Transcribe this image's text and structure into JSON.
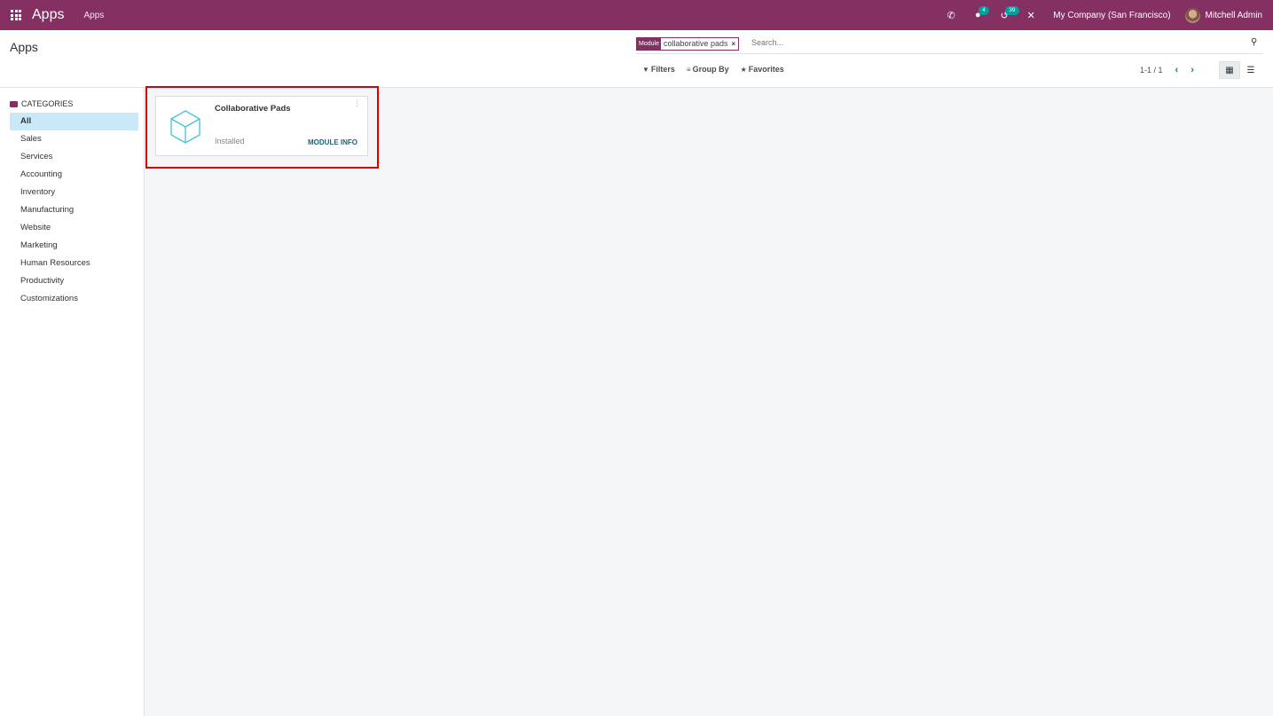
{
  "navbar": {
    "brand": "Apps",
    "menu_item": "Apps",
    "messages_count": "4",
    "activities_count": "39",
    "company": "My Company (San Francisco)",
    "user": "Mitchell Admin"
  },
  "control": {
    "title": "Apps",
    "facet_label": "Module",
    "facet_value": "collaborative pads",
    "search_placeholder": "Search...",
    "filters_label": "Filters",
    "groupby_label": "Group By",
    "favorites_label": "Favorites",
    "pager": "1-1 / 1"
  },
  "sidebar": {
    "header": "CATEGORIES",
    "items": [
      {
        "label": "All",
        "active": true
      },
      {
        "label": "Sales"
      },
      {
        "label": "Services"
      },
      {
        "label": "Accounting"
      },
      {
        "label": "Inventory"
      },
      {
        "label": "Manufacturing"
      },
      {
        "label": "Website"
      },
      {
        "label": "Marketing"
      },
      {
        "label": "Human Resources"
      },
      {
        "label": "Productivity"
      },
      {
        "label": "Customizations"
      }
    ]
  },
  "cards": [
    {
      "name": "Collaborative Pads",
      "status": "Installed",
      "action": "MODULE INFO"
    }
  ],
  "colors": {
    "brand": "#853063",
    "accent": "#017e84",
    "highlight": "#e00000"
  }
}
